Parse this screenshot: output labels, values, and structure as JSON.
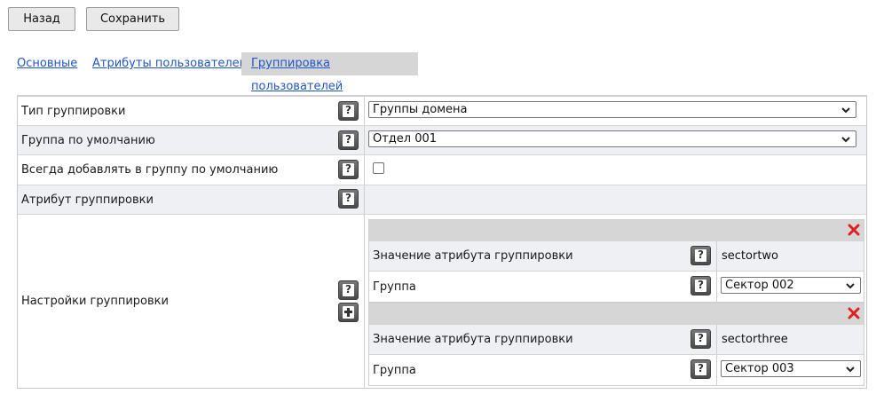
{
  "toolbar": {
    "back_label": "Назад",
    "save_label": "Сохранить"
  },
  "tabs": [
    {
      "label": "Основные",
      "active": false
    },
    {
      "label": "Атрибуты пользователей",
      "active": false
    },
    {
      "label": "Группировка пользователей",
      "active": true
    }
  ],
  "form": {
    "grouping_type": {
      "label": "Тип группировки",
      "value": "Группы домена"
    },
    "default_group": {
      "label": "Группа по умолчанию",
      "value": "Отдел 001"
    },
    "always_add": {
      "label": "Всегда добавлять в группу по умолчанию",
      "checked": false
    },
    "grouping_attribute": {
      "label": "Атрибут группировки",
      "value": ""
    },
    "grouping_settings": {
      "label": "Настройки группировки",
      "items": [
        {
          "attr_label": "Значение атрибута группировки",
          "attr_value": "sectortwo",
          "group_label": "Группа",
          "group_value": "Сектор 002"
        },
        {
          "attr_label": "Значение атрибута группировки",
          "attr_value": "sectorthree",
          "group_label": "Группа",
          "group_value": "Сектор 003"
        }
      ]
    }
  },
  "icons": {
    "help": "help-icon",
    "add": "add-icon",
    "delete": "delete-icon",
    "dropdown": "chevron-down-icon"
  },
  "colors": {
    "link": "#1f56c9",
    "delete": "#e02020",
    "active_tab_bg": "#d6d6d6"
  }
}
